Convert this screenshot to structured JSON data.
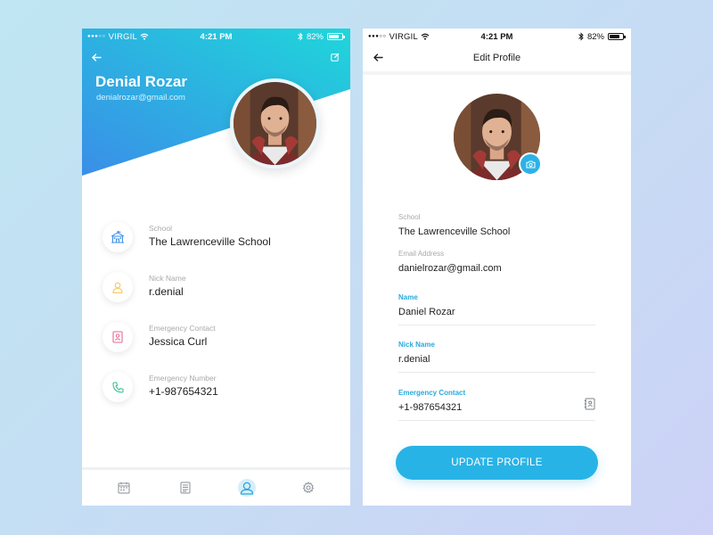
{
  "status_bar": {
    "carrier": "VIRGIL",
    "time": "4:21 PM",
    "battery": "82%",
    "battery_level": 0.82,
    "signal_dots": 5,
    "signal_filled": 3
  },
  "profile_screen": {
    "name": "Denial Rozar",
    "email": "denialrozar@gmail.com",
    "gradient_start": "#3a8ee8",
    "gradient_end": "#1fd6da",
    "items": [
      {
        "label": "School",
        "value": "The Lawrenceville School",
        "icon": "school-icon",
        "icon_color": "#3a8ee8"
      },
      {
        "label": "Nick Name",
        "value": "r.denial",
        "icon": "person-icon",
        "icon_color": "#f5c85a"
      },
      {
        "label": "Emergency Contact",
        "value": "Jessica Curl",
        "icon": "contact-card-icon",
        "icon_color": "#e36a93"
      },
      {
        "label": "Emergency Number",
        "value": "+1-987654321",
        "icon": "phone-icon",
        "icon_color": "#3ec08f"
      }
    ],
    "tabs": [
      {
        "name": "calendar",
        "icon": "calendar-icon",
        "active": false
      },
      {
        "name": "notes",
        "icon": "document-icon",
        "active": false
      },
      {
        "name": "profile",
        "icon": "profile-icon",
        "active": true
      },
      {
        "name": "settings",
        "icon": "gear-icon",
        "active": false
      }
    ]
  },
  "edit_screen": {
    "title": "Edit Profile",
    "fields": {
      "school": {
        "label": "School",
        "value": "The Lawrenceville School"
      },
      "email": {
        "label": "Email Address",
        "value": "danielrozar@gmail.com"
      },
      "name": {
        "label": "Name",
        "value": "Daniel Rozar"
      },
      "nick_name": {
        "label": "Nick Name",
        "value": "r.denial"
      },
      "emergency_contact": {
        "label": "Emergency Contact",
        "value": "+1-987654321"
      }
    },
    "update_button": "UPDATE PROFILE",
    "accent": "#28b3e6"
  }
}
